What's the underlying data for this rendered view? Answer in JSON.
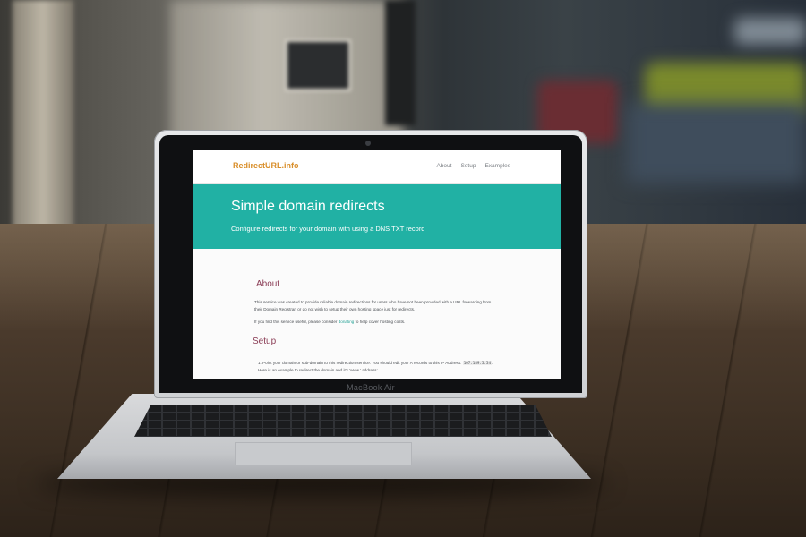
{
  "site": {
    "brand": "RedirectURL.info",
    "nav": [
      "About",
      "Setup",
      "Examples"
    ],
    "hero_title": "Simple domain redirects",
    "hero_subtitle": "Configure redirects for your domain with using a DNS TXT record",
    "about_heading": "About",
    "about_text": "This service was created to provide reliable domain redirections for users who have not been provided with a URL forwarding from their Domain Registrar, or do not wish to setup their own hosting space just for redirects.",
    "donate_before": "If you find this service useful, please consider ",
    "donate_link": "donating",
    "donate_after": " to help cover hosting costs.",
    "setup_heading": "Setup",
    "setup_step_before": "1.  Point your domain or sub-domain to this redirection service. You should edit your A records to this IP Address: ",
    "setup_ip": "107.189.5.54",
    "setup_step_after": ". Here is an example to redirect the domain and it's 'www.' address:"
  },
  "laptop": {
    "label": "MacBook Air"
  },
  "colors": {
    "hero": "#21b1a4",
    "brand": "#d98f2b",
    "heading": "#8a3c55"
  }
}
